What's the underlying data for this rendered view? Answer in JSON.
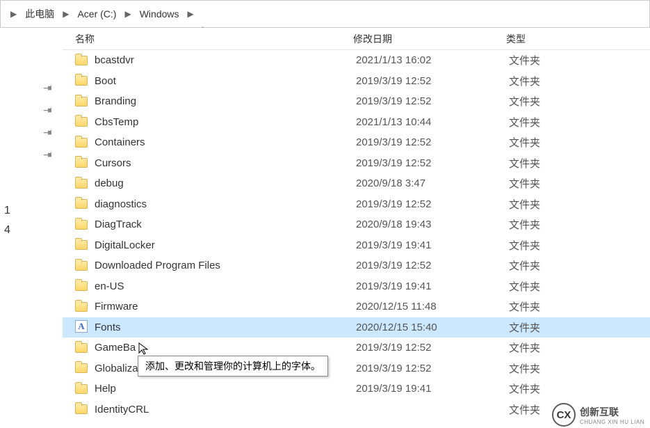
{
  "breadcrumb": {
    "items": [
      "此电脑",
      "Acer (C:)",
      "Windows"
    ]
  },
  "columns": {
    "name": "名称",
    "date": "修改日期",
    "type": "类型"
  },
  "sidebar": {
    "num1": "1",
    "num2": "4"
  },
  "tooltip": "添加、更改和管理你的计算机上的字体。",
  "files": [
    {
      "name": "bcastdvr",
      "date": "2021/1/13 16:02",
      "type": "文件夹",
      "icon": "folder"
    },
    {
      "name": "Boot",
      "date": "2019/3/19 12:52",
      "type": "文件夹",
      "icon": "folder"
    },
    {
      "name": "Branding",
      "date": "2019/3/19 12:52",
      "type": "文件夹",
      "icon": "folder"
    },
    {
      "name": "CbsTemp",
      "date": "2021/1/13 10:44",
      "type": "文件夹",
      "icon": "folder"
    },
    {
      "name": "Containers",
      "date": "2019/3/19 12:52",
      "type": "文件夹",
      "icon": "folder"
    },
    {
      "name": "Cursors",
      "date": "2019/3/19 12:52",
      "type": "文件夹",
      "icon": "folder"
    },
    {
      "name": "debug",
      "date": "2020/9/18 3:47",
      "type": "文件夹",
      "icon": "folder"
    },
    {
      "name": "diagnostics",
      "date": "2019/3/19 12:52",
      "type": "文件夹",
      "icon": "folder"
    },
    {
      "name": "DiagTrack",
      "date": "2020/9/18 19:43",
      "type": "文件夹",
      "icon": "folder"
    },
    {
      "name": "DigitalLocker",
      "date": "2019/3/19 19:41",
      "type": "文件夹",
      "icon": "folder"
    },
    {
      "name": "Downloaded Program Files",
      "date": "2019/3/19 12:52",
      "type": "文件夹",
      "icon": "folder"
    },
    {
      "name": "en-US",
      "date": "2019/3/19 19:41",
      "type": "文件夹",
      "icon": "folder"
    },
    {
      "name": "Firmware",
      "date": "2020/12/15 11:48",
      "type": "文件夹",
      "icon": "folder"
    },
    {
      "name": "Fonts",
      "date": "2020/12/15 15:40",
      "type": "文件夹",
      "icon": "fonts",
      "selected": true
    },
    {
      "name": "GameBa",
      "date": "2019/3/19 12:52",
      "type": "文件夹",
      "icon": "folder"
    },
    {
      "name": "Globalization",
      "date": "2019/3/19 12:52",
      "type": "文件夹",
      "icon": "folder"
    },
    {
      "name": "Help",
      "date": "2019/3/19 19:41",
      "type": "文件夹",
      "icon": "folder"
    },
    {
      "name": "IdentityCRL",
      "date": "",
      "type": "文件夹",
      "icon": "folder"
    }
  ],
  "watermark": {
    "cn": "创新互联",
    "py": "CHUANG XIN HU LIAN"
  }
}
